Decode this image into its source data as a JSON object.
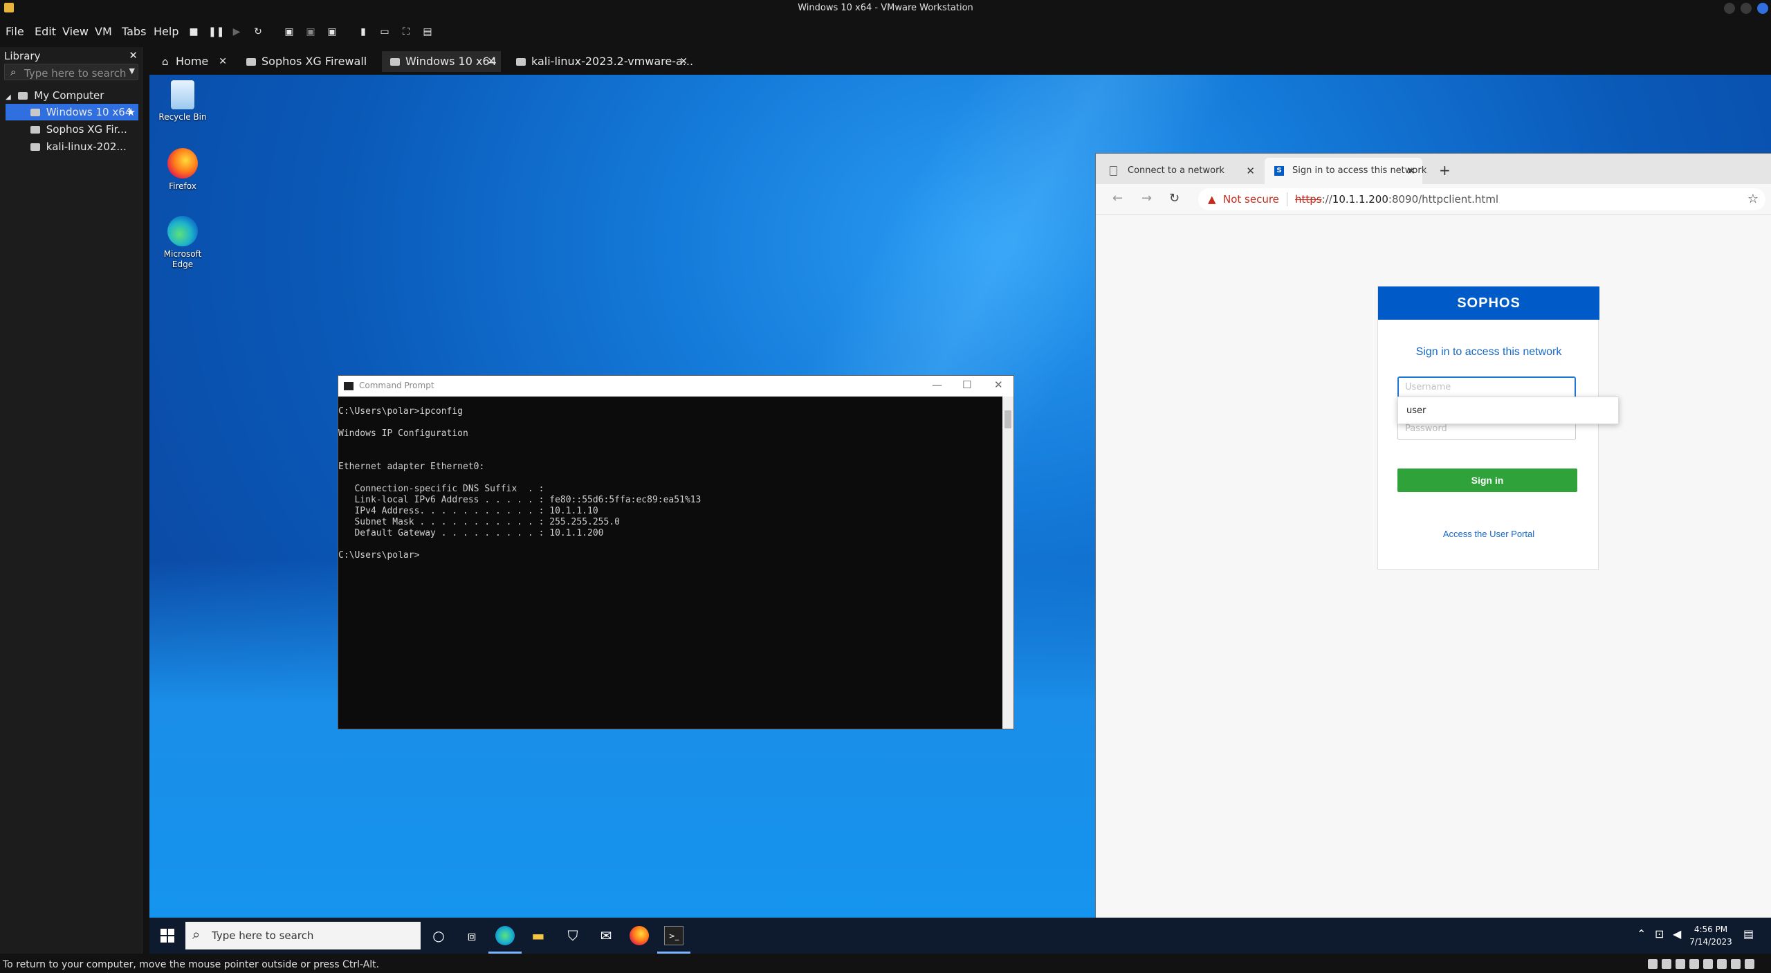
{
  "window": {
    "title": "Windows 10 x64 - VMware Workstation"
  },
  "menu": [
    "File",
    "Edit",
    "View",
    "VM",
    "Tabs",
    "Help"
  ],
  "library": {
    "title": "Library",
    "search_placeholder": "Type here to search",
    "root": "My Computer",
    "items": [
      "Windows 10 x64",
      "Sophos XG Fir...",
      "kali-linux-202..."
    ]
  },
  "vm_tabs": [
    {
      "label": "Home"
    },
    {
      "label": "Sophos XG Firewall"
    },
    {
      "label": "Windows 10 x64"
    },
    {
      "label": "kali-linux-2023.2-vmware-a..."
    }
  ],
  "desktop_icons": [
    "Recycle Bin",
    "Firefox",
    "Microsoft Edge"
  ],
  "cmd": {
    "title": "Command Prompt",
    "lines": [
      "C:\\Users\\polar>ipconfig",
      "",
      "Windows IP Configuration",
      "",
      "",
      "Ethernet adapter Ethernet0:",
      "",
      "   Connection-specific DNS Suffix  . :",
      "   Link-local IPv6 Address . . . . . : fe80::55d6:5ffa:ec89:ea51%13",
      "   IPv4 Address. . . . . . . . . . . : 10.1.1.10",
      "   Subnet Mask . . . . . . . . . . . : 255.255.255.0",
      "   Default Gateway . . . . . . . . . : 10.1.1.200",
      "",
      "C:\\Users\\polar>"
    ]
  },
  "browser": {
    "tabs": [
      {
        "label": "Connect to a network"
      },
      {
        "label": "Sign in to access this network"
      }
    ],
    "security": "Not secure",
    "url_scheme": "https",
    "url_sep": "://",
    "url_host": "10.1.1.200",
    "url_rest": ":8090/httpclient.html"
  },
  "portal": {
    "brand": "SOPHOS",
    "heading": "Sign in to access this network",
    "username_placeholder": "Username",
    "password_placeholder": "Password",
    "signin_label": "Sign in",
    "portal_link": "Access the User Portal",
    "autocomplete_option": "user"
  },
  "taskbar": {
    "search_placeholder": "Type here to search",
    "time": "4:56 PM",
    "date": "7/14/2023"
  },
  "statusbar": {
    "message": "To return to your computer, move the mouse pointer outside or press Ctrl-Alt."
  },
  "colors": {
    "sophos_blue": "#005bc8",
    "signin_green": "#2fa33a",
    "selection_blue": "#2f6fe0",
    "warning_red": "#c42b1c"
  }
}
